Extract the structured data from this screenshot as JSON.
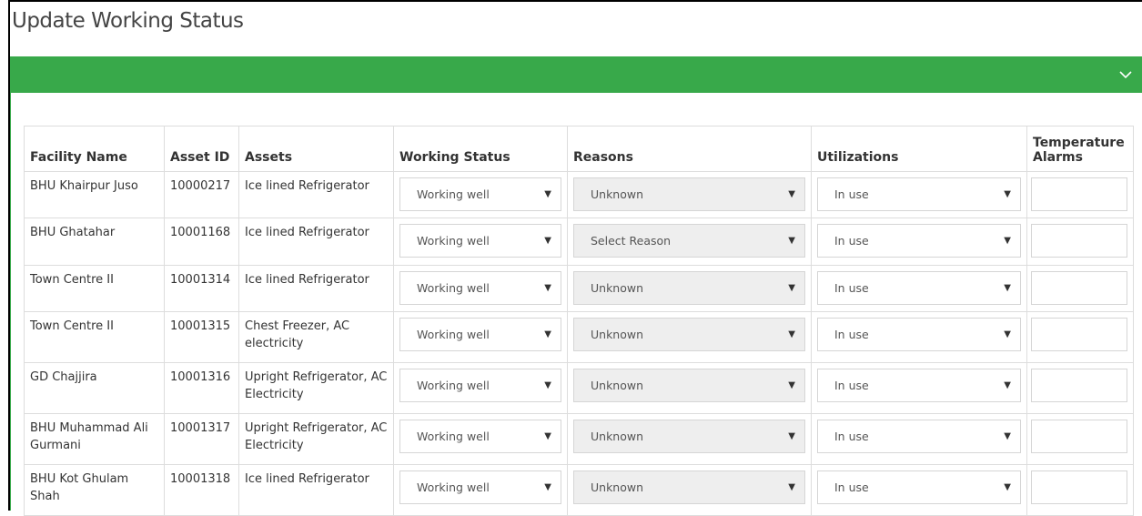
{
  "page": {
    "title": "Update Working Status"
  },
  "colors": {
    "panel_bar": "#38a94a",
    "disabled_field": "#eeeeee"
  },
  "panel": {
    "toggle_icon": "chevron-down-icon"
  },
  "table": {
    "headers": {
      "facility": "Facility Name",
      "asset_id": "Asset ID",
      "assets": "Assets",
      "working_status": "Working Status",
      "reasons": "Reasons",
      "utilizations": "Utilizations",
      "temperature_alarms": "Temperature Alarms"
    },
    "rows": [
      {
        "facility": "BHU Khairpur Juso",
        "asset_id": "10000217",
        "assets": "Ice lined Refrigerator",
        "working_status": "Working well",
        "reason": "Unknown",
        "utilization": "In use",
        "alarm": ""
      },
      {
        "facility": "BHU Ghatahar",
        "asset_id": "10001168",
        "assets": "Ice lined Refrigerator",
        "working_status": "Working well",
        "reason": "Select Reason",
        "utilization": "In use",
        "alarm": ""
      },
      {
        "facility": "Town Centre II",
        "asset_id": "10001314",
        "assets": "Ice lined Refrigerator",
        "working_status": "Working well",
        "reason": "Unknown",
        "utilization": "In use",
        "alarm": ""
      },
      {
        "facility": "Town Centre II",
        "asset_id": "10001315",
        "assets": "Chest Freezer, AC electricity",
        "working_status": "Working well",
        "reason": "Unknown",
        "utilization": "In use",
        "alarm": ""
      },
      {
        "facility": "GD Chajjira",
        "asset_id": "10001316",
        "assets": "Upright Refrigerator, AC Electricity",
        "working_status": "Working well",
        "reason": "Unknown",
        "utilization": "In use",
        "alarm": ""
      },
      {
        "facility": "BHU Muhammad Ali Gurmani",
        "asset_id": "10001317",
        "assets": "Upright Refrigerator, AC Electricity",
        "working_status": "Working well",
        "reason": "Unknown",
        "utilization": "In use",
        "alarm": ""
      },
      {
        "facility": "BHU Kot Ghulam Shah",
        "asset_id": "10001318",
        "assets": "Ice lined Refrigerator",
        "working_status": "Working well",
        "reason": "Unknown",
        "utilization": "In use",
        "alarm": ""
      }
    ]
  }
}
